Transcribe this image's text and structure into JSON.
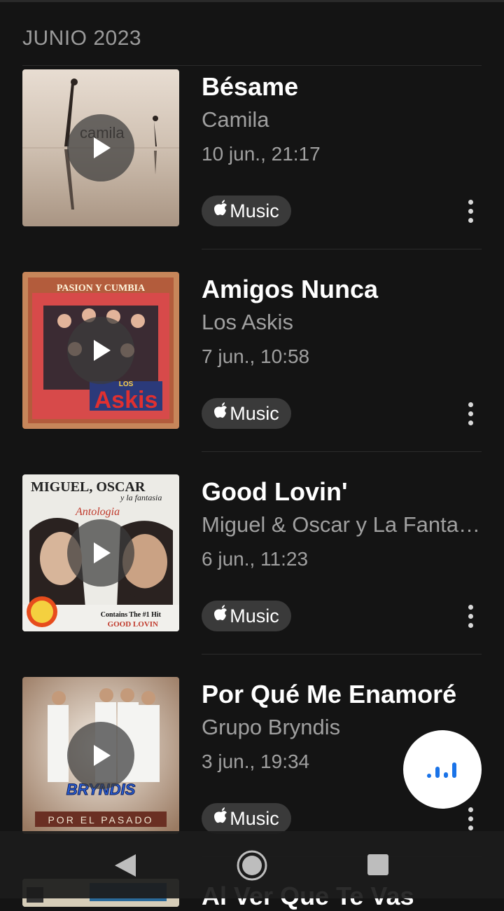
{
  "section": {
    "label": "JUNIO 2023"
  },
  "badge": {
    "label": "Music",
    "icon": "apple-icon"
  },
  "songs": [
    {
      "title": "Bésame",
      "artist": "Camila",
      "date": "10 jun., 21:17",
      "cover_text": "camila"
    },
    {
      "title": "Amigos Nunca",
      "artist": "Los Askis",
      "date": "7 jun., 10:58",
      "cover_text": "PASION Y CUMBIA",
      "cover_logo": "Askis",
      "cover_logo_small": "LOS"
    },
    {
      "title": "Good Lovin'",
      "artist": "Miguel & Oscar y La Fantasía",
      "date": "6 jun., 11:23",
      "cover_text": "MIGUEL, OSCAR",
      "cover_sub": "y la fantasia",
      "cover_tag": "Antologia",
      "cover_note1": "Contains The #1 Hit",
      "cover_note2": "GOOD LOVIN"
    },
    {
      "title": "Por Qué Me Enamoré",
      "artist": "Grupo Bryndis",
      "date": "3 jun., 19:34",
      "cover_logo": "BRYNDIS",
      "cover_text": "POR EL PASADO"
    }
  ],
  "peek": {
    "title": "Al Ver Que Te Vas"
  },
  "colors": {
    "background": "#141414",
    "badge": "#3a3a3a",
    "fab_icon": "#1a73e8"
  }
}
